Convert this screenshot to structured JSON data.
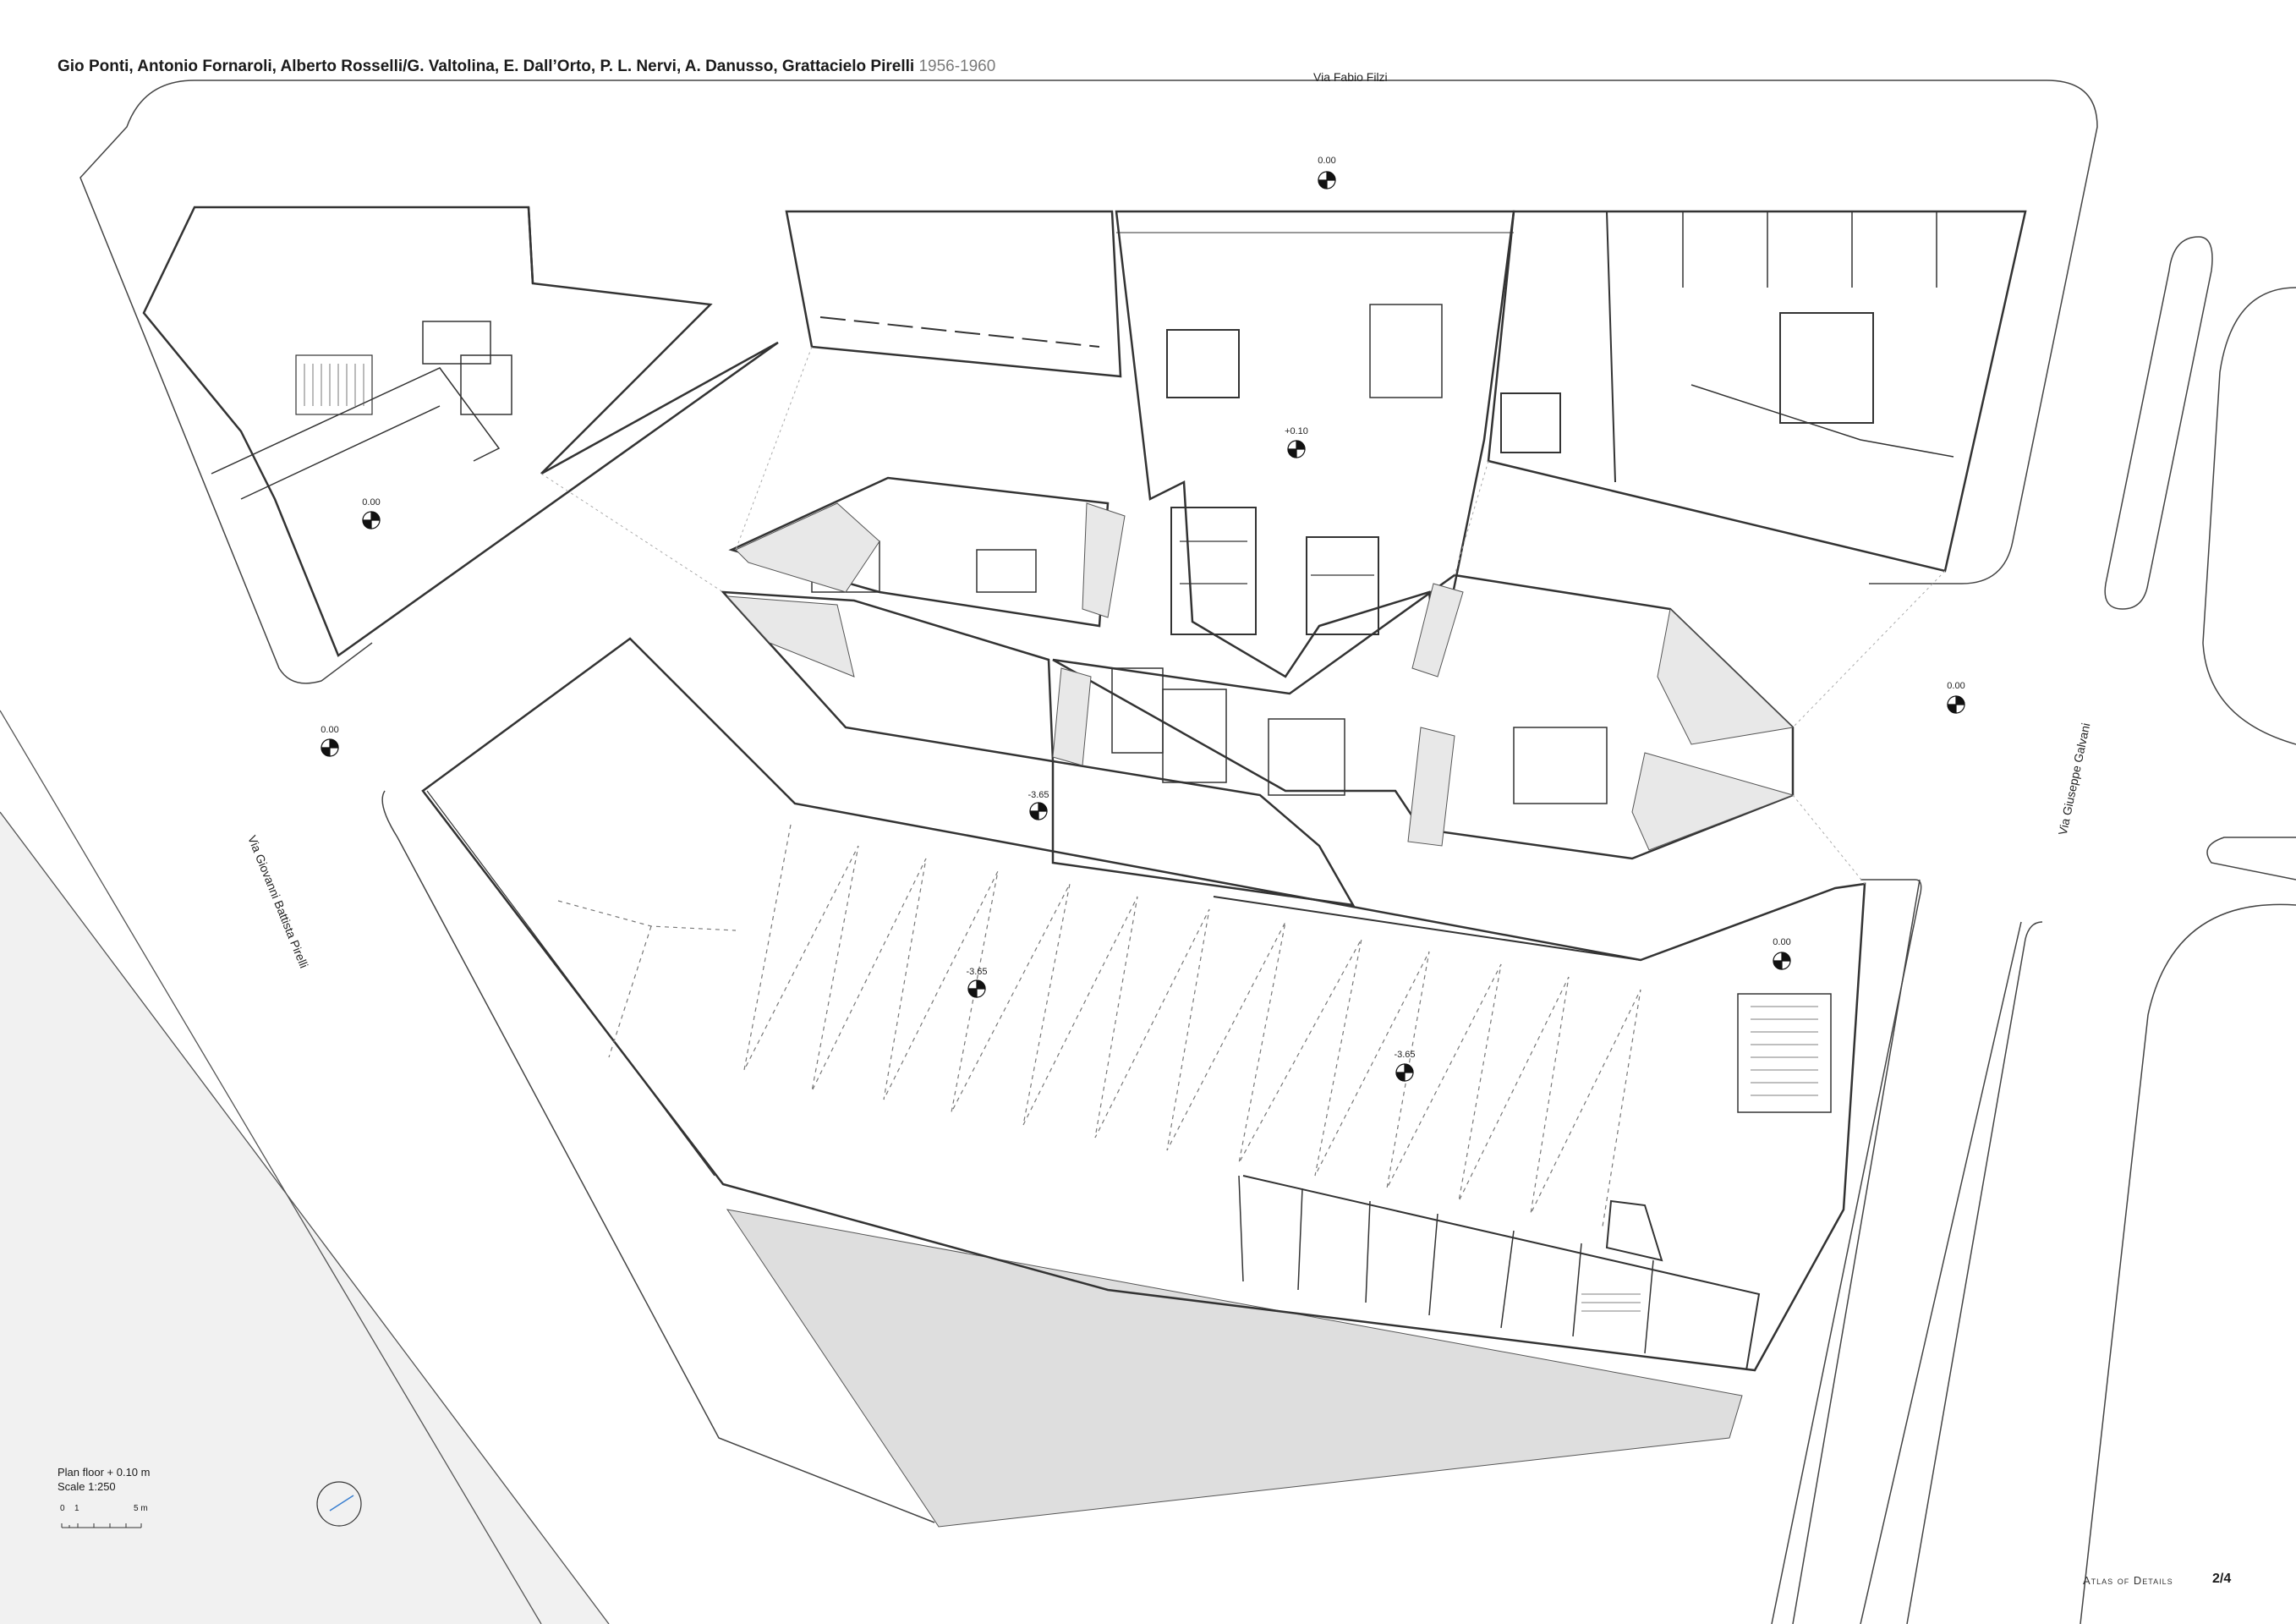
{
  "header": {
    "authors_title": "Gio Ponti, Antonio Fornaroli, Alberto Rosselli/G. Valtolina, E. Dall’Orto, P. L. Nervi, A. Danusso, Grattacielo Pirelli",
    "years": "1956-1960"
  },
  "streets": {
    "north": "Via Fabio Filzi",
    "east": "Via Giuseppe Galvani",
    "west": "Via Giovanni Battista Pirelli"
  },
  "levels": {
    "north_plaza": "0.00",
    "west_block": "0.00",
    "lobby": "+0.10",
    "west_plaza": "0.00",
    "east_plaza": "0.00",
    "ramp": "-3.65",
    "sunken_west": "-3.65",
    "sunken_east": "-3.65",
    "southeast_block": "0.00"
  },
  "legend": {
    "plan_label": "Plan floor + 0.10 m",
    "scale_label": "Scale 1:250",
    "scalebar_ticks": [
      "0",
      "1",
      "5 m"
    ]
  },
  "footer": {
    "atlas": "Atlas of Details",
    "page": "2/4"
  },
  "colors": {
    "ink": "#222222",
    "grey_fill": "#dcdcdc",
    "light_fill": "#eeeeee",
    "years_grey": "#7a7a7a"
  }
}
